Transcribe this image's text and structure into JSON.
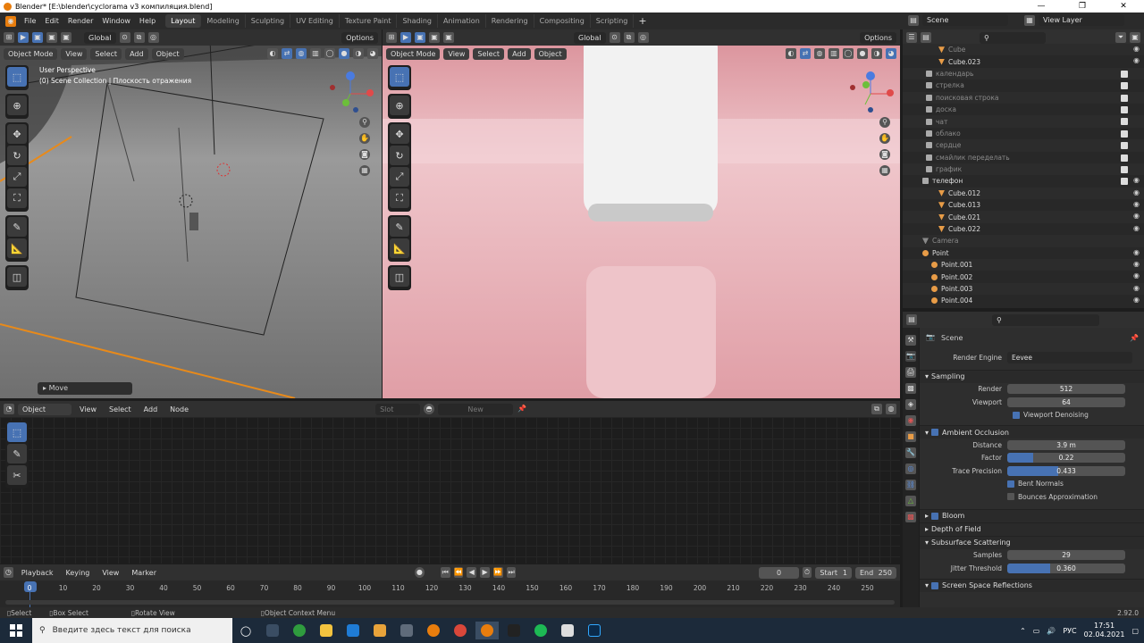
{
  "window": {
    "title": "Blender* [E:\\blender\\cyclorama v3 компиляция.blend]"
  },
  "menu": {
    "items": [
      "File",
      "Edit",
      "Render",
      "Window",
      "Help"
    ],
    "workspaces": [
      "Layout",
      "Modeling",
      "Sculpting",
      "UV Editing",
      "Texture Paint",
      "Shading",
      "Animation",
      "Rendering",
      "Compositing",
      "Scripting"
    ],
    "active_workspace": "Layout",
    "scene": "Scene",
    "view_layer": "View Layer"
  },
  "viewport_left": {
    "orientation": "Global",
    "options": "Options",
    "mode": "Object Mode",
    "menus": [
      "View",
      "Select",
      "Add",
      "Object"
    ],
    "overlay_line1": "User Perspective",
    "overlay_line2": "(0) Scene Collection | Плоскость отражения",
    "operator_panel": "Move"
  },
  "viewport_right": {
    "orientation": "Global",
    "options": "Options",
    "mode": "Object Mode",
    "menus": [
      "View",
      "Select",
      "Add",
      "Object"
    ]
  },
  "node_editor": {
    "type": "Object",
    "menus": [
      "View",
      "Select",
      "Add",
      "Node"
    ],
    "slot": "Slot",
    "new_label": "New"
  },
  "outliner": {
    "rows": [
      {
        "label": "Cube",
        "type": "mesh",
        "dim": true,
        "eye": true,
        "check": false
      },
      {
        "label": "Cube.023",
        "type": "mesh",
        "dim": false,
        "eye": true,
        "check": false
      },
      {
        "label": "календарь",
        "type": "coll",
        "dim": true,
        "eye": false,
        "check": true
      },
      {
        "label": "стрелка",
        "type": "coll",
        "dim": true,
        "eye": false,
        "check": true
      },
      {
        "label": "поисковая строка",
        "type": "coll",
        "dim": true,
        "eye": false,
        "check": true
      },
      {
        "label": "доска",
        "type": "coll",
        "dim": true,
        "eye": false,
        "check": true
      },
      {
        "label": "чат",
        "type": "coll",
        "dim": true,
        "eye": false,
        "check": true
      },
      {
        "label": "облако",
        "type": "coll",
        "dim": true,
        "eye": false,
        "check": true
      },
      {
        "label": "сердце",
        "type": "coll",
        "dim": true,
        "eye": false,
        "check": true
      },
      {
        "label": "смайлик переделать",
        "type": "coll",
        "dim": true,
        "eye": false,
        "check": true
      },
      {
        "label": "график",
        "type": "coll",
        "dim": true,
        "eye": false,
        "check": true
      },
      {
        "label": "телефон",
        "type": "coll",
        "dim": false,
        "eye": true,
        "check": true
      },
      {
        "label": "Cube.012",
        "type": "mesh",
        "dim": false,
        "eye": true,
        "check": false
      },
      {
        "label": "Cube.013",
        "type": "mesh",
        "dim": false,
        "eye": true,
        "check": false
      },
      {
        "label": "Cube.021",
        "type": "mesh",
        "dim": false,
        "eye": true,
        "check": false
      },
      {
        "label": "Cube.022",
        "type": "mesh",
        "dim": false,
        "eye": true,
        "check": false
      },
      {
        "label": "Camera",
        "type": "cam",
        "dim": true,
        "eye": false,
        "check": false
      },
      {
        "label": "Point",
        "type": "light",
        "dim": false,
        "eye": true,
        "check": false
      },
      {
        "label": "Point.001",
        "type": "light",
        "dim": false,
        "eye": true,
        "check": false
      },
      {
        "label": "Point.002",
        "type": "light",
        "dim": false,
        "eye": true,
        "check": false
      },
      {
        "label": "Point.003",
        "type": "light",
        "dim": false,
        "eye": true,
        "check": false
      },
      {
        "label": "Point.004",
        "type": "light",
        "dim": false,
        "eye": true,
        "check": false
      }
    ]
  },
  "properties": {
    "context": "Scene",
    "render_engine_label": "Render Engine",
    "render_engine": "Eevee",
    "sampling": {
      "title": "Sampling",
      "render_label": "Render",
      "render": "512",
      "viewport_label": "Viewport",
      "viewport": "64",
      "denoise": "Viewport Denoising"
    },
    "ao": {
      "title": "Ambient Occlusion",
      "distance_label": "Distance",
      "distance": "3.9 m",
      "factor_label": "Factor",
      "factor": "0.22",
      "factor_fill": 0.22,
      "trace_label": "Trace Precision",
      "trace": "0.433",
      "trace_fill": 0.433,
      "bent": "Bent Normals",
      "bounces": "Bounces Approximation"
    },
    "bloom": "Bloom",
    "dof": "Depth of Field",
    "sss": {
      "title": "Subsurface Scattering",
      "samples_label": "Samples",
      "samples": "29",
      "jitter_label": "Jitter Threshold",
      "jitter": "0.360",
      "jitter_fill": 0.36
    },
    "ssr": "Screen Space Reflections"
  },
  "timeline": {
    "menus": [
      "Playback",
      "Keying",
      "View",
      "Marker"
    ],
    "frame": "0",
    "start_label": "Start",
    "start": "1",
    "end_label": "End",
    "end": "250",
    "ticks": [
      "0",
      "10",
      "20",
      "30",
      "40",
      "50",
      "60",
      "70",
      "80",
      "90",
      "100",
      "110",
      "120",
      "130",
      "140",
      "150",
      "160",
      "170",
      "180",
      "190",
      "200",
      "210",
      "220",
      "230",
      "240",
      "250"
    ]
  },
  "statusbar": {
    "select": "Select",
    "box_select": "Box Select",
    "rotate": "Rotate View",
    "context_menu": "Object Context Menu",
    "version": "2.92.0"
  },
  "taskbar": {
    "search_placeholder": "Введите здесь текст для поиска",
    "lang": "РУС",
    "time": "17:51",
    "date": "02.04.2021"
  }
}
